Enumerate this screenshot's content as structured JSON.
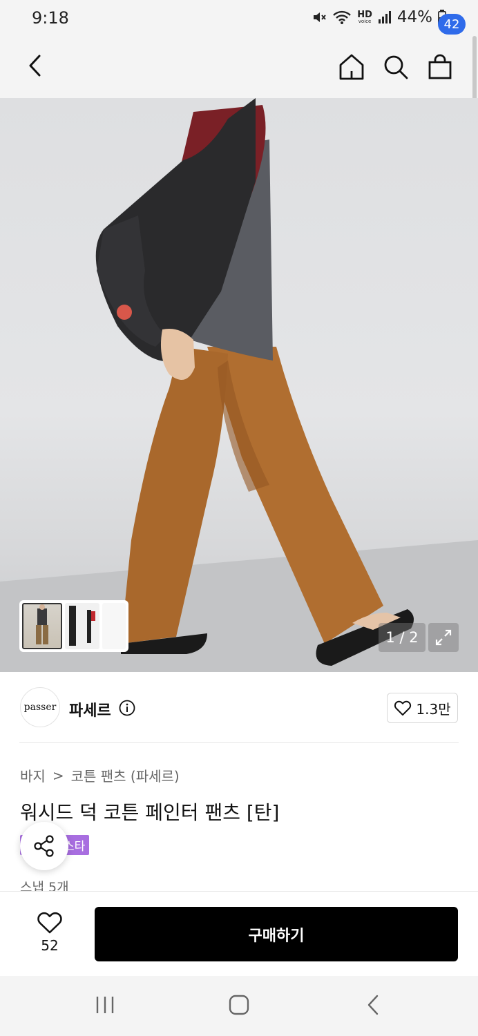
{
  "status_bar": {
    "time": "9:18",
    "hd_top": "HD",
    "hd_bottom": "voice",
    "battery": "44%"
  },
  "header": {
    "cart_count": "42"
  },
  "hero": {
    "page_counter": "1 / 2"
  },
  "brand": {
    "logo_text": "passer",
    "name": "파세르",
    "like_count": "1.3만"
  },
  "breadcrumb": {
    "category": "바지",
    "separator": ">",
    "subcategory": "코튼 팬츠 (파세르)"
  },
  "product": {
    "title": "워시드 덕 코튼 페인터 팬츠 [탄]",
    "tag": "스타",
    "snap_count": "스냅 5개"
  },
  "action_bar": {
    "fav_count": "52",
    "buy_label": "구매하기"
  },
  "colors": {
    "accent_blue": "#2f6bea",
    "tag_purple": "#a86ee0",
    "buy_button": "#000000"
  },
  "icons": [
    "back-icon",
    "home-icon",
    "search-icon",
    "cart-icon",
    "info-icon",
    "heart-icon",
    "share-icon",
    "expand-icon",
    "nav-recents-icon",
    "nav-home-icon",
    "nav-back-icon"
  ]
}
